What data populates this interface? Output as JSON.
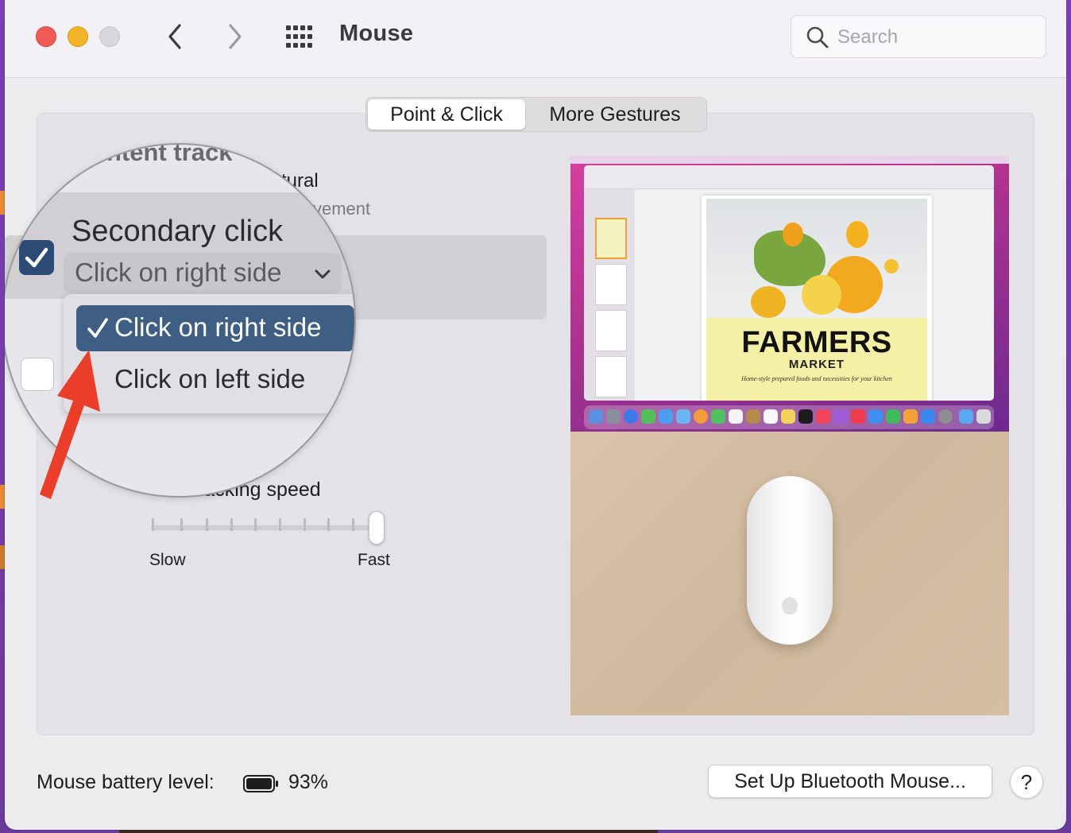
{
  "window": {
    "title": "Mouse"
  },
  "search": {
    "placeholder": "Search"
  },
  "tabs": [
    {
      "label": "Point & Click",
      "active": true
    },
    {
      "label": "More Gestures",
      "active": false
    }
  ],
  "settings": {
    "natural_fragment": "tural",
    "natural_sub_fragment": "vement",
    "tracking_speed_label": "racking speed",
    "tracking_speed_fraction": 1.0,
    "slider_min_label": "Slow",
    "slider_max_label": "Fast"
  },
  "magnifier": {
    "top_fragment": "ntent track",
    "secondary_click_title": "Secondary click",
    "secondary_click_value": "Click on right side",
    "menu_options": [
      {
        "label": "Click on right side",
        "selected": true
      },
      {
        "label": "Click on left side",
        "selected": false
      }
    ]
  },
  "preview": {
    "doc_title": "FARMERS",
    "doc_subtitle": "MARKET",
    "doc_tagline": "Home-style prepared foods and necessities for your kitchen"
  },
  "footer": {
    "battery_label": "Mouse battery level:",
    "battery_value": "93%",
    "bluetooth_button": "Set Up Bluetooth Mouse...",
    "help_button": "?"
  },
  "colors": {
    "accent_blue": "#2b4a76",
    "selected_menu": "#3e5e84",
    "annotation_arrow": "#ea3e2a"
  }
}
